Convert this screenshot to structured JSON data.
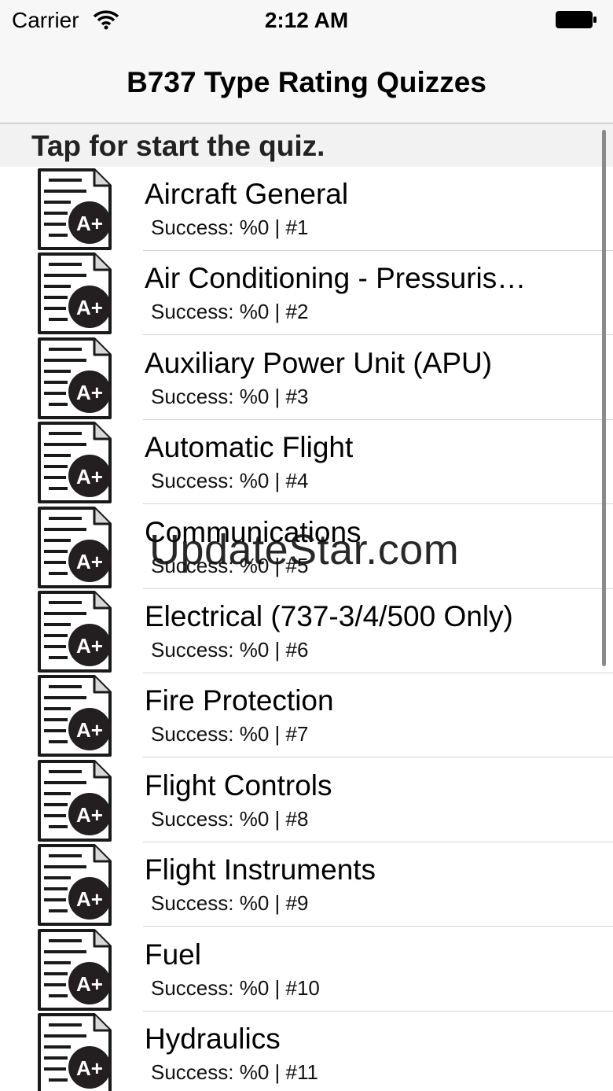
{
  "status_bar": {
    "carrier": "Carrier",
    "time": "2:12 AM"
  },
  "nav": {
    "title": "B737 Type Rating Quizzes"
  },
  "section": {
    "label": "Tap for start the quiz."
  },
  "icon": {
    "badge": "A+"
  },
  "quizzes": [
    {
      "title": "Aircraft General",
      "subtitle": "Success: %0 |  #1"
    },
    {
      "title": "Air Conditioning - Pressuris…",
      "subtitle": "Success: %0 |  #2"
    },
    {
      "title": "Auxiliary Power Unit (APU)",
      "subtitle": "Success: %0 |  #3"
    },
    {
      "title": "Automatic Flight",
      "subtitle": "Success: %0 |  #4"
    },
    {
      "title": "Communications",
      "subtitle": "Success: %0 |  #5"
    },
    {
      "title": "Electrical (737-3/4/500 Only)",
      "subtitle": "Success: %0 |  #6"
    },
    {
      "title": "Fire Protection",
      "subtitle": "Success: %0 |  #7"
    },
    {
      "title": "Flight Controls",
      "subtitle": "Success: %0 |  #8"
    },
    {
      "title": "Flight Instruments",
      "subtitle": "Success: %0 |  #9"
    },
    {
      "title": "Fuel",
      "subtitle": "Success: %0 |  #10"
    },
    {
      "title": "Hydraulics",
      "subtitle": "Success: %0 |  #11"
    }
  ],
  "watermark": "UpdateStar.com"
}
